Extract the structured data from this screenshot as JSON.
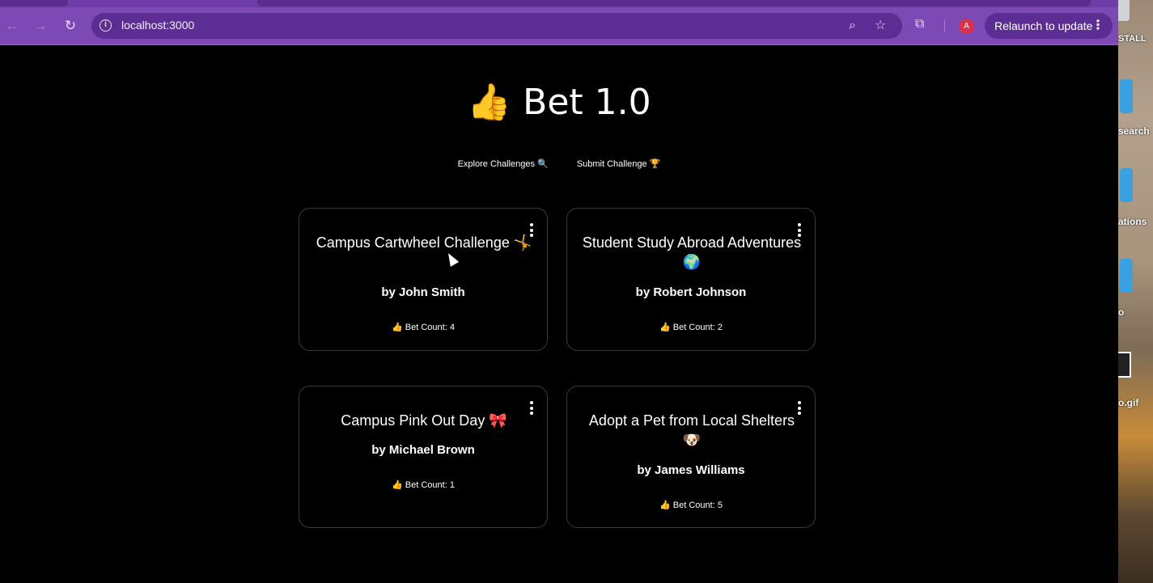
{
  "browser": {
    "url": "localhost:3000",
    "relaunch_label": "Relaunch to update",
    "avatar_letter": "A"
  },
  "desktop": {
    "labels": [
      "STALL",
      "search",
      "ations",
      "o",
      "o.gif"
    ]
  },
  "page": {
    "title": "👍 Bet 1.0",
    "nav": {
      "explore": "Explore Challenges 🔍",
      "submit": "Submit Challenge 🏆"
    }
  },
  "cards": [
    {
      "title": "Campus Cartwheel Challenge 🤸",
      "author": "by John Smith",
      "count": "👍 Bet Count: 4"
    },
    {
      "title": "Student Study Abroad Adventures 🌍",
      "author": "by Robert Johnson",
      "count": "👍 Bet Count: 2"
    },
    {
      "title": "Campus Pink Out Day 🎀",
      "author": "by Michael Brown",
      "count": "👍 Bet Count: 1"
    },
    {
      "title": "Adopt a Pet from Local Shelters 🐶",
      "author": "by James Williams",
      "count": "👍 Bet Count: 5"
    }
  ]
}
